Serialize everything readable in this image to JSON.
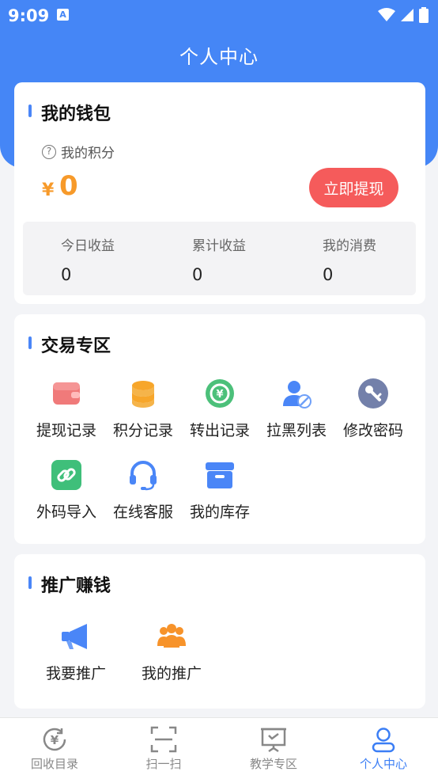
{
  "status_bar": {
    "time": "9:09"
  },
  "header": {
    "title": "个人中心"
  },
  "wallet": {
    "title": "我的钱包",
    "points_label": "我的积分",
    "currency_symbol": "¥",
    "amount": "0",
    "withdraw_label": "立即提现",
    "stats": [
      {
        "label": "今日收益",
        "value": "0"
      },
      {
        "label": "累计收益",
        "value": "0"
      },
      {
        "label": "我的消费",
        "value": "0"
      }
    ]
  },
  "trade": {
    "title": "交易专区",
    "items": [
      {
        "label": "提现记录",
        "icon": "wallet-icon",
        "color": "#f06b6b"
      },
      {
        "label": "积分记录",
        "icon": "coins-icon",
        "color": "#f7a62a"
      },
      {
        "label": "转出记录",
        "icon": "transfer-icon",
        "color": "#4cc07a"
      },
      {
        "label": "拉黑列表",
        "icon": "block-user-icon",
        "color": "#4a86f7"
      },
      {
        "label": "修改密码",
        "icon": "key-icon",
        "color": "#6f7fae"
      },
      {
        "label": "外码导入",
        "icon": "link-icon",
        "color": "#3fbf7a"
      },
      {
        "label": "在线客服",
        "icon": "headset-icon",
        "color": "#4a86f7"
      },
      {
        "label": "我的库存",
        "icon": "inventory-icon",
        "color": "#4a86f7"
      }
    ]
  },
  "promo": {
    "title": "推广赚钱",
    "items": [
      {
        "label": "我要推广",
        "icon": "megaphone-icon",
        "color": "#4a86f7"
      },
      {
        "label": "我的推广",
        "icon": "team-icon",
        "color": "#f7932a"
      }
    ]
  },
  "tabbar": {
    "active_color": "#3b7ef5",
    "items": [
      {
        "label": "回收目录",
        "icon": "recycle-yen-icon"
      },
      {
        "label": "扫一扫",
        "icon": "scan-icon"
      },
      {
        "label": "教学专区",
        "icon": "teaching-icon"
      },
      {
        "label": "个人中心",
        "icon": "user-icon"
      }
    ]
  }
}
